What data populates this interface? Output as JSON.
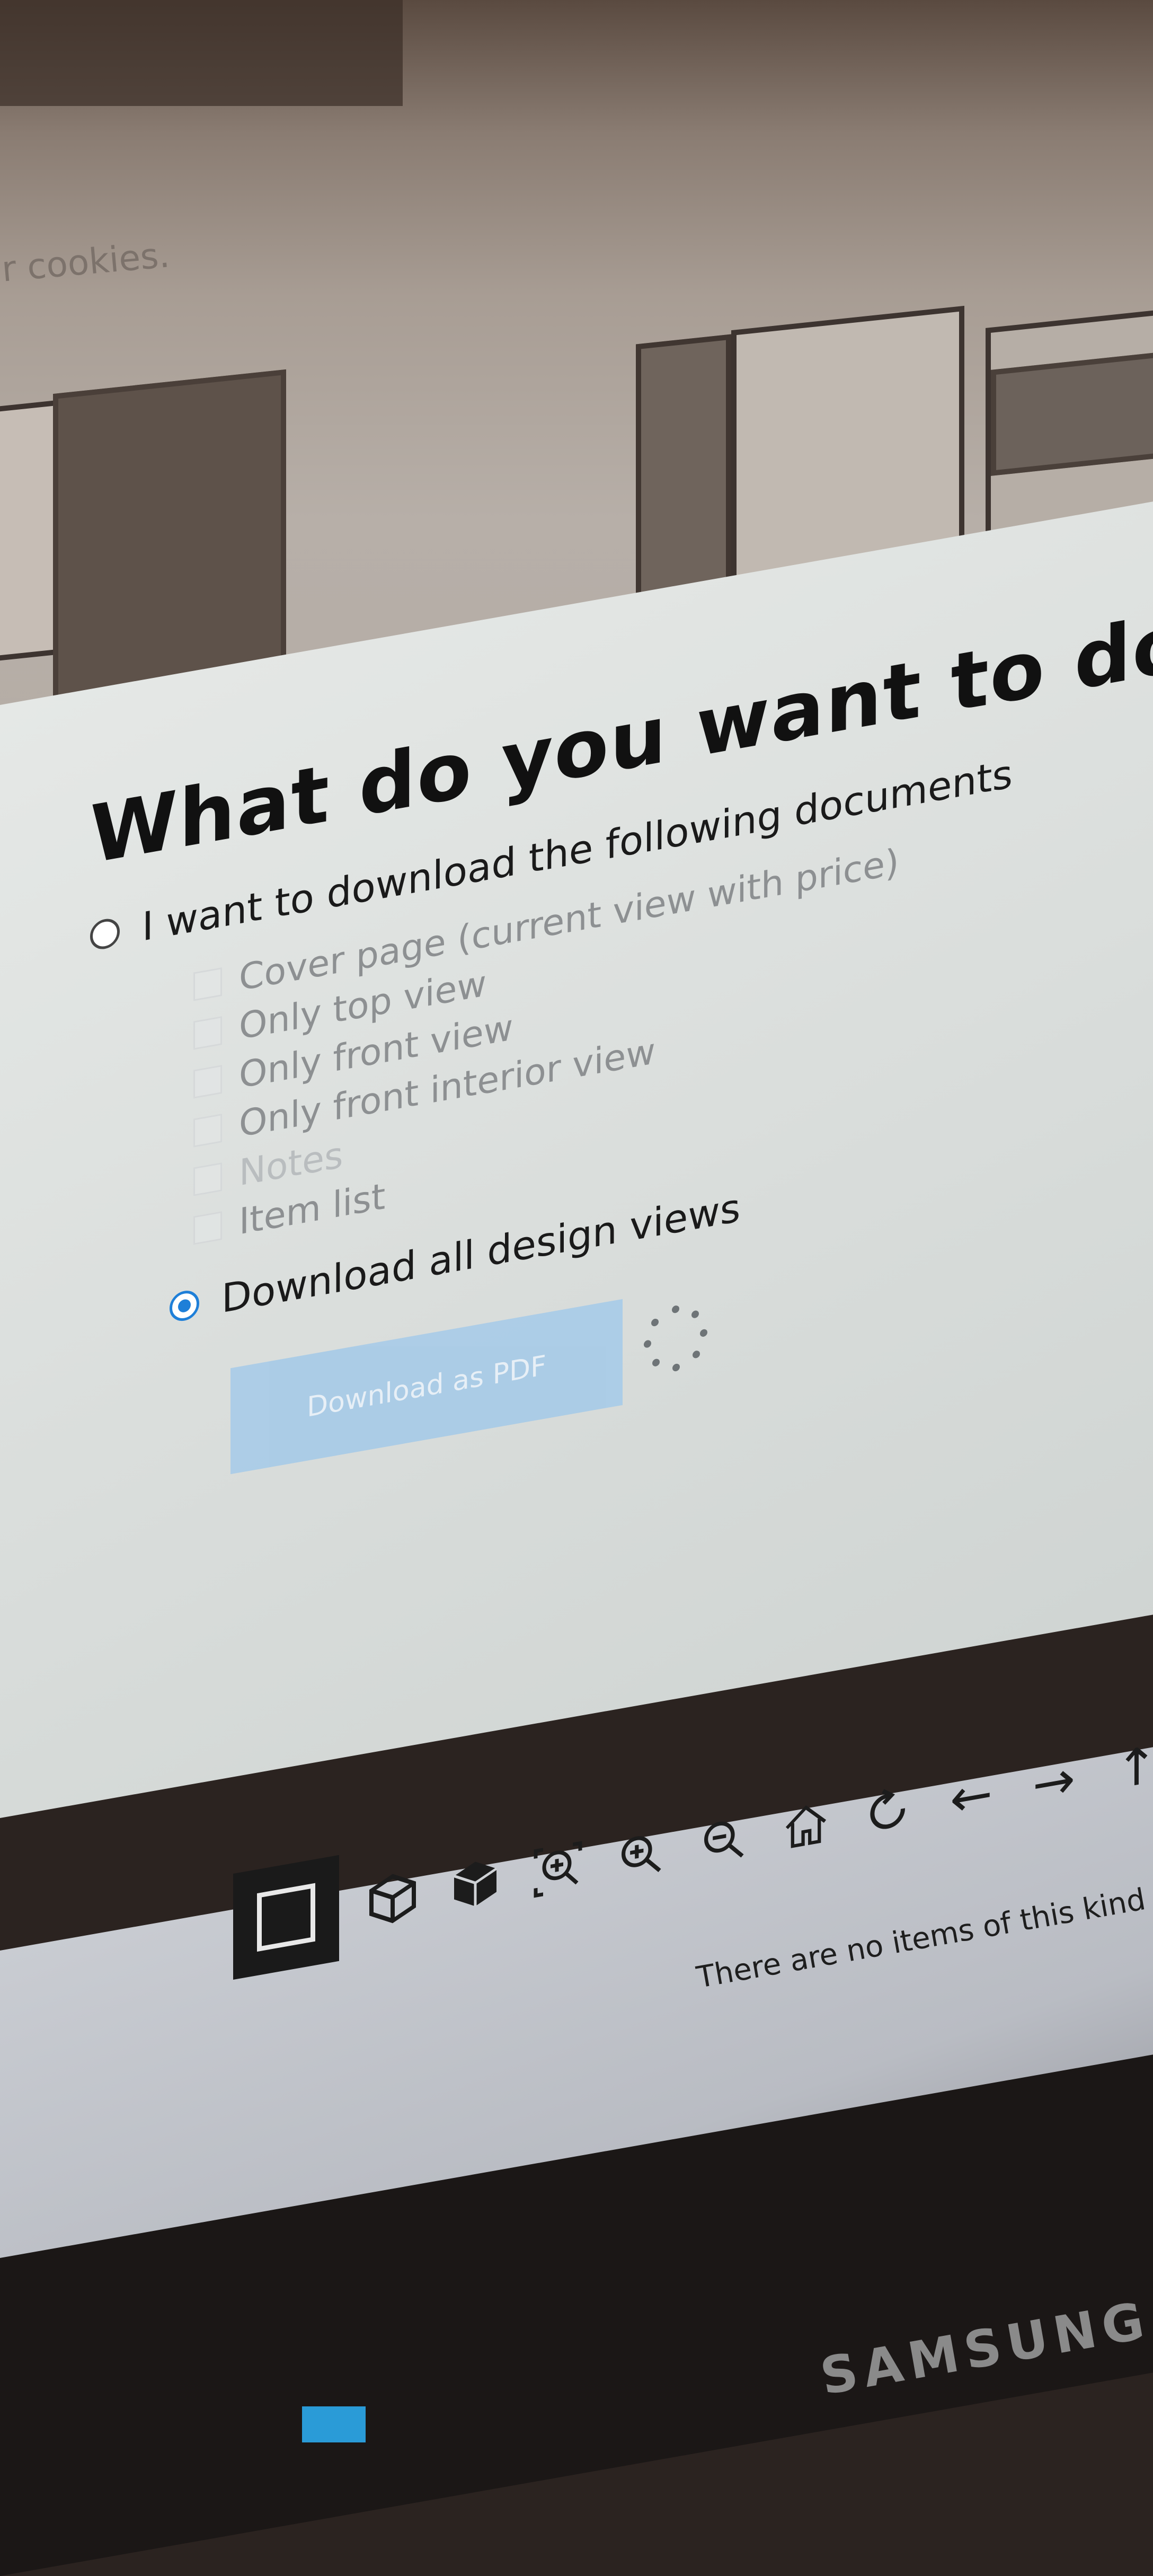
{
  "background": {
    "cookies_text": "r cookies."
  },
  "dialog": {
    "title": "What do you want to dowr",
    "option_documents": {
      "label": "I want to download the following documents",
      "selected": false
    },
    "documents": [
      {
        "label": "Cover page (current view with price)",
        "enabled": false
      },
      {
        "label": "Only top view",
        "enabled": false
      },
      {
        "label": "Only front view",
        "enabled": false
      },
      {
        "label": "Only front interior view",
        "enabled": false
      },
      {
        "label": "Notes",
        "enabled": false
      },
      {
        "label": "Item list",
        "enabled": false
      }
    ],
    "option_all_views": {
      "label": "Download all design views",
      "selected": true
    },
    "download_button": "Download as PDF"
  },
  "toolbar": {
    "icons": [
      "2d-view-icon",
      "3d-wireframe-icon",
      "3d-solid-icon",
      "zoom-fit-icon",
      "zoom-in-icon",
      "zoom-out-icon",
      "home-icon",
      "rotate-icon",
      "arrow-left-icon",
      "arrow-right-icon",
      "arrow-up-icon"
    ]
  },
  "item_list": {
    "empty_message": "There are no items of this kind"
  },
  "monitor": {
    "brand": "SAMSUNG"
  },
  "colors": {
    "accent": "#1e7fd8",
    "button_disabled": "#a7cbe8"
  }
}
